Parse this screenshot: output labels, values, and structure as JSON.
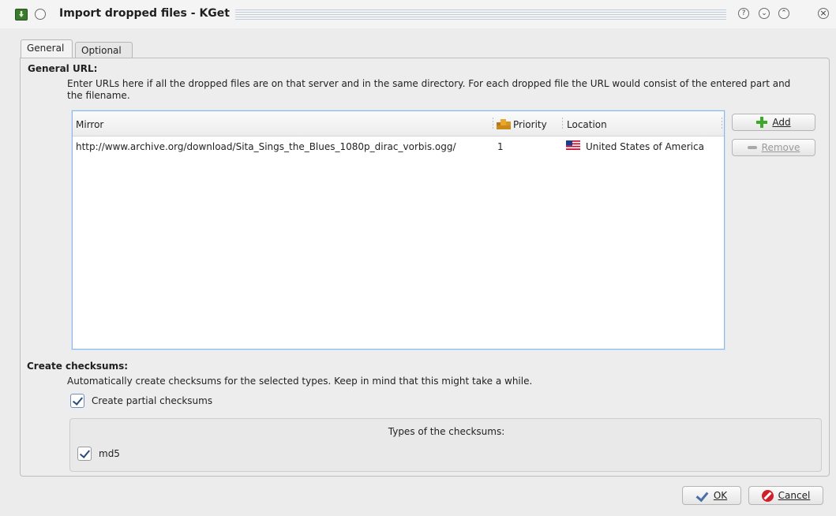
{
  "window": {
    "title": "Import dropped files - KGet",
    "help_glyph": "?",
    "min_glyph": "⌄",
    "max_glyph": "⌃",
    "close_glyph": "×"
  },
  "tabs": [
    {
      "label": "General",
      "active": true
    },
    {
      "label": "Optional",
      "active": false
    }
  ],
  "general_url": {
    "heading": "General URL:",
    "description_line1": "Enter URLs here if all the dropped files are on that server and in the same directory. For each dropped file the URL would consist of the entered part and",
    "description_line2": "the filename."
  },
  "mirror_table": {
    "columns": {
      "mirror": "Mirror",
      "priority": "Priority",
      "location": "Location"
    },
    "rows": [
      {
        "mirror": "http://www.archive.org/download/Sita_Sings_the_Blues_1080p_dirac_vorbis.ogg/",
        "priority": "1",
        "location": "United States of America",
        "flag": "us-flag"
      }
    ]
  },
  "side_buttons": {
    "add": "Add",
    "remove": "Remove"
  },
  "checksums": {
    "heading": "Create checksums:",
    "description": "Automatically create checksums for the selected types. Keep in mind that this might take a while.",
    "partial_label": "Create partial checksums",
    "partial_checked": true,
    "types_title": "Types of the checksums:",
    "types": [
      {
        "label": "md5",
        "checked": true
      }
    ]
  },
  "footer": {
    "ok": "OK",
    "cancel": "Cancel"
  },
  "colors": {
    "selection_border": "#8fb7e6",
    "add_green": "#3ea82a",
    "cancel_red": "#d0202a"
  }
}
